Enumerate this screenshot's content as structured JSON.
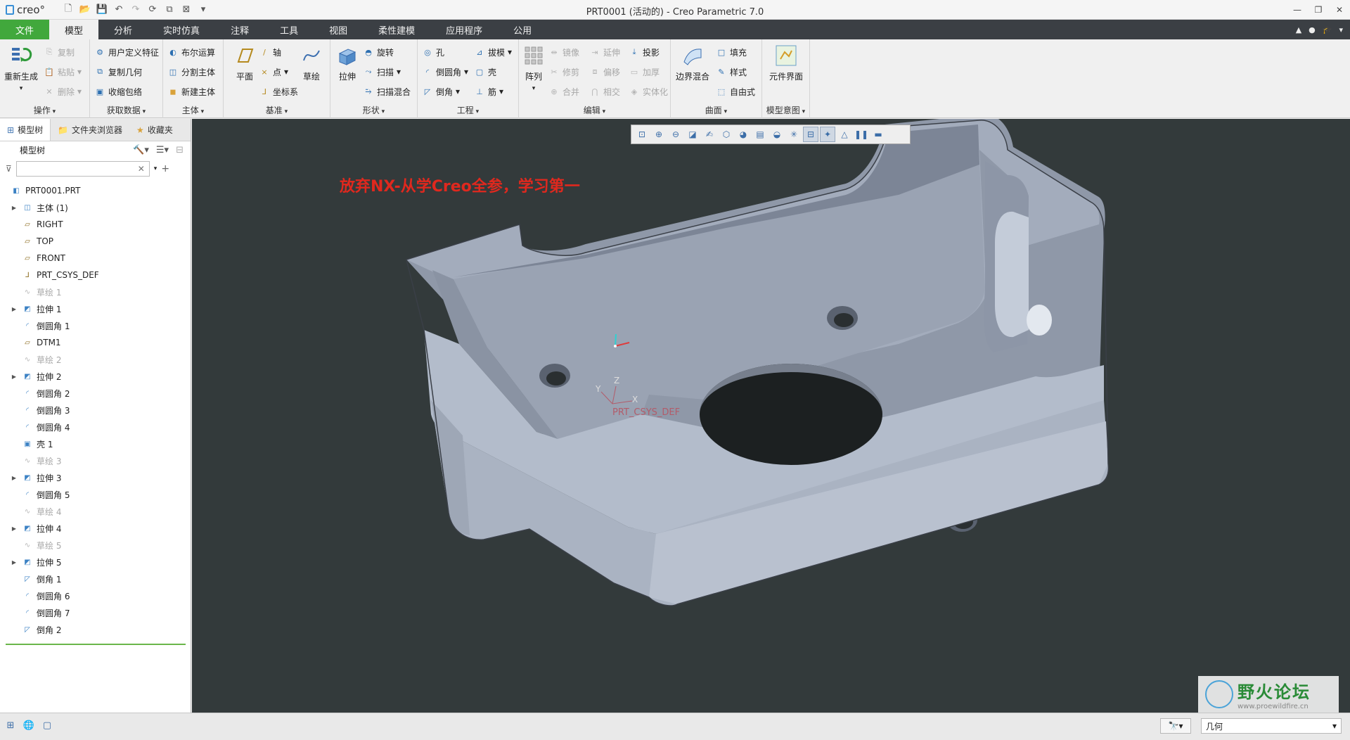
{
  "app": {
    "logo_text": "creo°",
    "window_title": "PRT0001 (活动的) - Creo Parametric 7.0"
  },
  "tabs": [
    {
      "label": "文件"
    },
    {
      "label": "模型"
    },
    {
      "label": "分析"
    },
    {
      "label": "实时仿真"
    },
    {
      "label": "注释"
    },
    {
      "label": "工具"
    },
    {
      "label": "视图"
    },
    {
      "label": "柔性建模"
    },
    {
      "label": "应用程序"
    },
    {
      "label": "公用"
    }
  ],
  "ribbon": {
    "operations": {
      "title": "操作",
      "regenerate": "重新生成",
      "copy": "复制",
      "paste": "粘贴",
      "delete": "删除"
    },
    "get_data": {
      "title": "获取数据",
      "udf": "用户定义特征",
      "copy_geom": "复制几何",
      "shrinkwrap": "收缩包络"
    },
    "body": {
      "title": "主体",
      "boolean": "布尔运算",
      "split": "分割主体",
      "new_body": "新建主体"
    },
    "datum": {
      "title": "基准",
      "plane": "平面",
      "axis": "轴",
      "point": "点",
      "csys": "坐标系",
      "sketch": "草绘"
    },
    "shapes": {
      "title": "形状",
      "extrude": "拉伸",
      "revolve": "旋转",
      "sweep": "扫描",
      "swept_blend": "扫描混合"
    },
    "engineering": {
      "title": "工程",
      "hole": "孔",
      "round": "倒圆角",
      "chamfer": "倒角",
      "draft": "拔模",
      "shell": "壳",
      "rib": "筋"
    },
    "editing": {
      "title": "编辑",
      "pattern": "阵列",
      "mirror": "镜像",
      "trim": "修剪",
      "merge": "合并",
      "extend": "延伸",
      "offset": "偏移",
      "intersect": "相交",
      "project": "投影",
      "thicken": "加厚",
      "solidify": "实体化"
    },
    "surfaces": {
      "title": "曲面",
      "boundary_blend": "边界混合",
      "fill": "填充",
      "style": "样式",
      "freestyle": "自由式"
    },
    "model_intent": {
      "title": "模型意图",
      "component_interface": "元件界面"
    }
  },
  "left_panel": {
    "tabs": [
      {
        "label": "模型树"
      },
      {
        "label": "文件夹浏览器"
      },
      {
        "label": "收藏夹"
      }
    ],
    "tree_header": "模型树",
    "filter_placeholder": "",
    "items": [
      {
        "label": "PRT0001.PRT"
      },
      {
        "label": "主体 (1)"
      },
      {
        "label": "RIGHT"
      },
      {
        "label": "TOP"
      },
      {
        "label": "FRONT"
      },
      {
        "label": "PRT_CSYS_DEF"
      },
      {
        "label": "草绘 1"
      },
      {
        "label": "拉伸 1"
      },
      {
        "label": "倒圆角 1"
      },
      {
        "label": "DTM1"
      },
      {
        "label": "草绘 2"
      },
      {
        "label": "拉伸 2"
      },
      {
        "label": "倒圆角 2"
      },
      {
        "label": "倒圆角 3"
      },
      {
        "label": "倒圆角 4"
      },
      {
        "label": "壳 1"
      },
      {
        "label": "草绘 3"
      },
      {
        "label": "拉伸 3"
      },
      {
        "label": "倒圆角 5"
      },
      {
        "label": "草绘 4"
      },
      {
        "label": "拉伸 4"
      },
      {
        "label": "草绘 5"
      },
      {
        "label": "拉伸 5"
      },
      {
        "label": "倒角 1"
      },
      {
        "label": "倒圆角 6"
      },
      {
        "label": "倒圆角 7"
      },
      {
        "label": "倒角 2"
      }
    ]
  },
  "viewport": {
    "overlay_text": "放弃NX-从学Creo全参，学习第一",
    "csys_label": "PRT_CSYS_DEF",
    "axis_x": "X",
    "axis_y": "Y",
    "axis_z": "Z",
    "model_color": "#a9b3c4",
    "background_color": "#333a3b"
  },
  "watermark": {
    "title": "野火论坛",
    "url": "www.proewildfire.cn"
  },
  "status": {
    "find_label": "🔭",
    "selection_filter": "几何"
  }
}
